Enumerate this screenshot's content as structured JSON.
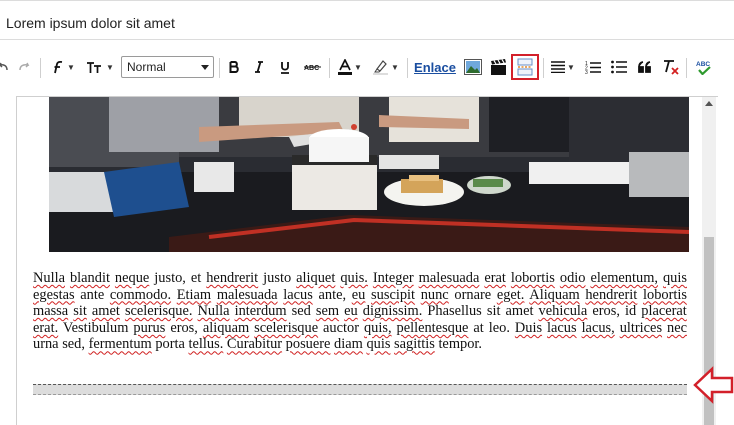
{
  "document": {
    "title": "Lorem ipsum dolor sit amet"
  },
  "toolbar": {
    "format_value": "Normal",
    "link_label": "Enlace",
    "accent_highlight": "#d3202a"
  },
  "content": {
    "words": [
      {
        "t": "Nulla",
        "u": true
      },
      {
        "t": "blandit",
        "u": true
      },
      {
        "t": "neque",
        "u": true
      },
      {
        "t": "justo,"
      },
      {
        "t": "et"
      },
      {
        "t": "hendrerit",
        "u": true
      },
      {
        "t": "justo"
      },
      {
        "t": "aliquet",
        "u": true
      },
      {
        "t": "quis.",
        "u": true
      },
      {
        "t": "Integer",
        "u": true
      },
      {
        "t": "malesuada",
        "u": true
      },
      {
        "t": "erat",
        "u": true
      },
      {
        "t": "lobortis",
        "u": true
      },
      {
        "t": "odio",
        "u": true
      },
      {
        "t": "elementum,",
        "u": true
      },
      {
        "t": "quis",
        "u": true
      },
      {
        "t": "egestas",
        "u": true
      },
      {
        "t": "ante"
      },
      {
        "t": "commodo.",
        "u": true
      },
      {
        "t": "Etiam",
        "u": true
      },
      {
        "t": "malesuada",
        "u": true
      },
      {
        "t": "lacus",
        "u": true
      },
      {
        "t": "ante,"
      },
      {
        "t": "eu",
        "u": true
      },
      {
        "t": "suscipit",
        "u": true
      },
      {
        "t": "nunc",
        "u": true
      },
      {
        "t": "ornare"
      },
      {
        "t": "eget.",
        "u": true
      },
      {
        "t": "Aliquam",
        "u": true
      },
      {
        "t": "hendrerit",
        "u": true
      },
      {
        "t": "lobortis",
        "u": true
      },
      {
        "t": "massa",
        "u": true
      },
      {
        "t": "sit",
        "u": true
      },
      {
        "t": "amet",
        "u": true
      },
      {
        "t": "scelerisque.",
        "u": true
      },
      {
        "t": "Nulla",
        "u": true
      },
      {
        "t": "interdum",
        "u": true
      },
      {
        "t": "sed"
      },
      {
        "t": "sem",
        "u": true
      },
      {
        "t": "eu",
        "u": true
      },
      {
        "t": "dignissim.",
        "u": true
      },
      {
        "t": "Phasellus"
      },
      {
        "t": "sit"
      },
      {
        "t": "amet"
      },
      {
        "t": "vehicula",
        "u": true
      },
      {
        "t": "eros,"
      },
      {
        "t": "id"
      },
      {
        "t": "placerat",
        "u": true
      },
      {
        "t": "erat.",
        "u": true
      },
      {
        "t": "Vestibulum"
      },
      {
        "t": "purus",
        "u": true
      },
      {
        "t": "eros,"
      },
      {
        "t": "aliquam",
        "u": true
      },
      {
        "t": "scelerisque",
        "u": true
      },
      {
        "t": "auctor"
      },
      {
        "t": "quis,",
        "u": true
      },
      {
        "t": "pellentesque",
        "u": true
      },
      {
        "t": "at"
      },
      {
        "t": "leo."
      },
      {
        "t": "Duis",
        "u": true
      },
      {
        "t": "lacus",
        "u": true
      },
      {
        "t": "lacus,",
        "u": true
      },
      {
        "t": "ultrices",
        "u": true
      },
      {
        "t": "nec",
        "u": true
      },
      {
        "t": "urna"
      },
      {
        "t": "sed,"
      },
      {
        "t": "fermentum",
        "u": true
      },
      {
        "t": "porta"
      },
      {
        "t": "tellus.",
        "u": true
      },
      {
        "t": "Curabitur",
        "u": true
      },
      {
        "t": "posuere",
        "u": true
      },
      {
        "t": "diam",
        "u": true
      },
      {
        "t": "quis",
        "u": true
      },
      {
        "t": "sagittis",
        "u": true
      },
      {
        "t": "tempor."
      }
    ]
  }
}
